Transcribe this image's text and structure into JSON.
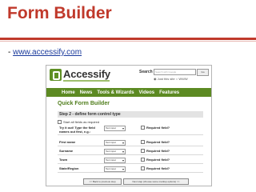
{
  "slide": {
    "title": "Form Builder",
    "subtitle_prefix": "- ",
    "link": "www.accessify.com"
  },
  "site": {
    "logo": "Accessify",
    "search_label": "Search",
    "search_placeholder": "Search with Google",
    "go": "Go",
    "search_options": [
      "Just this site",
      "WWW"
    ],
    "nav": [
      "Home",
      "News",
      "Tools & Wizards",
      "Videos",
      "Features"
    ]
  },
  "form": {
    "heading": "Quick Form Builder",
    "step": "Step 2 - define form control type",
    "start_all_required": "Start all fields as required",
    "required_label": "Required field?",
    "rows": [
      {
        "label": "Try it out! Type the field",
        "label2": "names out first, e.g.:",
        "type": "Text input"
      },
      {
        "label": "First name",
        "type": "Text input"
      },
      {
        "label": "Surname",
        "type": "Text input"
      },
      {
        "label": "Town",
        "type": "Text input"
      },
      {
        "label": "State/Region",
        "type": "Text input"
      }
    ],
    "back_button": "<< Back to previous step",
    "next_button": "Next step (choose some markup options) >>"
  },
  "colors": {
    "title_red": "#c0392b",
    "brand_green": "#5c8a22",
    "link_blue": "#1a3a9c"
  }
}
